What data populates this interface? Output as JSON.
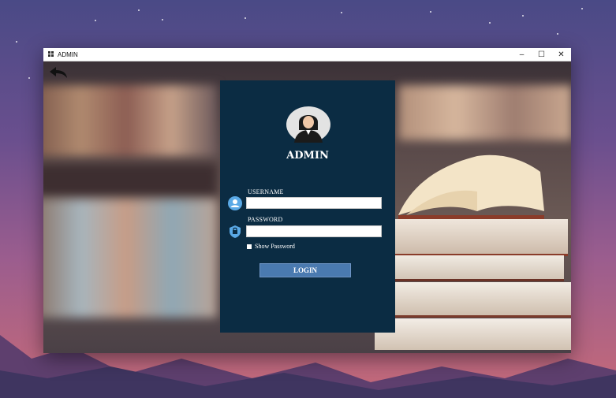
{
  "window": {
    "title": "ADMIN",
    "controls": {
      "minimize": "–",
      "maximize": "☐",
      "close": "✕"
    }
  },
  "login": {
    "heading": "ADMIN",
    "username_label": "USERNAME",
    "username_value": "",
    "password_label": "PASSWORD",
    "password_value": "",
    "show_password_label": "Show Password",
    "show_password_checked": false,
    "login_button": "LOGIN"
  },
  "icons": {
    "back": "back-arrow-icon",
    "avatar": "user-avatar-icon",
    "username": "user-icon",
    "password": "lock-shield-icon"
  },
  "colors": {
    "panel": "#0b2c43",
    "login_button": "#4a7ab0",
    "sky_top": "#4a4a86",
    "sky_bottom": "#c66a78"
  }
}
